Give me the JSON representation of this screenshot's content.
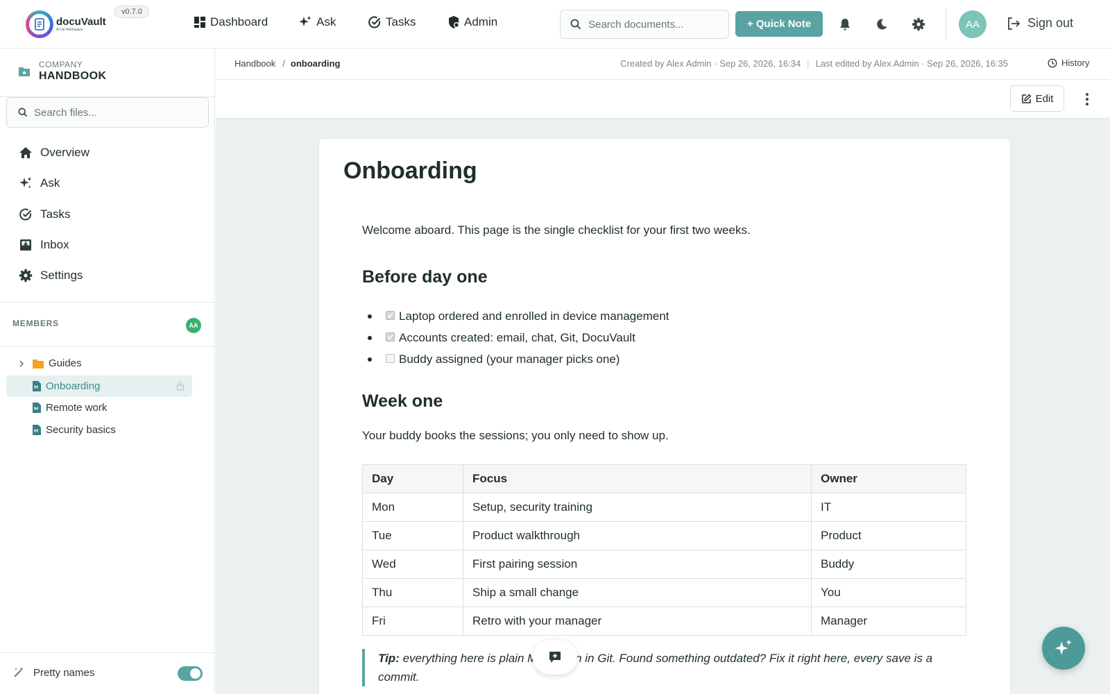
{
  "app": {
    "name": "docuVault",
    "tagline": "AI Git Workspace",
    "version": "v0.7.0",
    "accent": "#5aa3a3"
  },
  "topnav": {
    "items": [
      {
        "label": "Dashboard",
        "icon": "dashboard-icon"
      },
      {
        "label": "Ask",
        "icon": "sparkle-icon"
      },
      {
        "label": "Tasks",
        "icon": "check-circle-icon"
      },
      {
        "label": "Admin",
        "icon": "shield-icon"
      }
    ],
    "search_placeholder": "Search documents...",
    "quick_note": "+ Quick Note",
    "avatar": "AA",
    "sign_out": "Sign out"
  },
  "sidebar": {
    "workspace_label": "COMPANY",
    "workspace_name": "HANDBOOK",
    "search_placeholder": "Search files...",
    "menu": [
      {
        "label": "Overview",
        "icon": "home-icon"
      },
      {
        "label": "Ask",
        "icon": "sparkle-icon"
      },
      {
        "label": "Tasks",
        "icon": "check-circle-icon"
      },
      {
        "label": "Inbox",
        "icon": "inbox-icon"
      },
      {
        "label": "Settings",
        "icon": "gear-icon"
      }
    ],
    "members_label": "MEMBERS",
    "members_avatar": "AA",
    "tree": [
      {
        "label": "Guides",
        "type": "folder"
      },
      {
        "label": "Onboarding",
        "type": "file",
        "active": true
      },
      {
        "label": "Remote work",
        "type": "file"
      },
      {
        "label": "Security basics",
        "type": "file"
      }
    ],
    "pretty_names": "Pretty names"
  },
  "breadcrumb": {
    "parent": "Handbook",
    "separator": "/",
    "current": "onboarding"
  },
  "meta": {
    "created": "Created by Alex Admin · Sep 26, 2026, 16:34",
    "edited": "Last edited by Alex Admin · Sep 26, 2026, 16:35",
    "history": "History"
  },
  "toolbar": {
    "edit": "Edit"
  },
  "doc": {
    "title": "Onboarding",
    "intro": "Welcome aboard. This page is the single checklist for your first two weeks.",
    "section1": "Before day one",
    "checklist": [
      {
        "label": "Laptop ordered and enrolled in device management",
        "checked": true
      },
      {
        "label": "Accounts created: email, chat, Git, DocuVault",
        "checked": true
      },
      {
        "label": "Buddy assigned (your manager picks one)",
        "checked": false
      }
    ],
    "section2": "Week one",
    "section2_text": "Your buddy books the sessions; you only need to show up.",
    "table": {
      "headers": [
        "Day",
        "Focus",
        "Owner"
      ],
      "rows": [
        [
          "Mon",
          "Setup, security training",
          "IT"
        ],
        [
          "Tue",
          "Product walkthrough",
          "Product"
        ],
        [
          "Wed",
          "First pairing session",
          "Buddy"
        ],
        [
          "Thu",
          "Ship a small change",
          "You"
        ],
        [
          "Fri",
          "Retro with your manager",
          "Manager"
        ]
      ]
    },
    "tip_label": "Tip:",
    "tip_text": " everything here is plain Markdown in Git. Found something outdated? Fix it right here, every save is a commit."
  }
}
